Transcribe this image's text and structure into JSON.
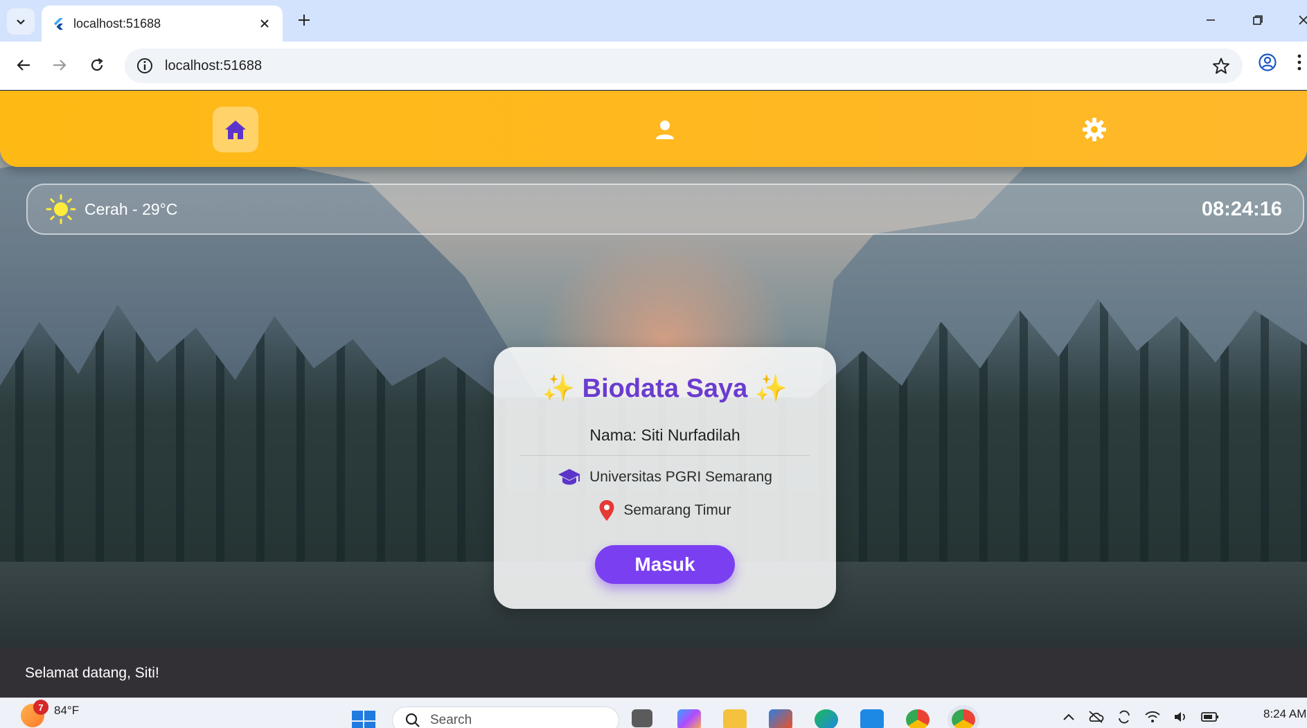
{
  "browser": {
    "tab_title": "localhost:51688",
    "url": "localhost:51688"
  },
  "app": {
    "nav_items": [
      {
        "name": "home",
        "icon": "home-icon",
        "active": true
      },
      {
        "name": "profile",
        "icon": "person-icon",
        "active": false
      },
      {
        "name": "settings",
        "icon": "gear-icon",
        "active": false
      }
    ],
    "accent_color": "#ffb914",
    "weather": {
      "icon": "sun-icon",
      "text": "Cerah - 29°C",
      "clock": "08:24:16"
    },
    "card": {
      "title": "✨ Biodata Saya ✨",
      "name": "Nama: Siti Nurfadilah",
      "university": "Universitas PGRI Semarang",
      "location": "Semarang Timur",
      "button_label": "Masuk",
      "button_color": "#7b3ff2",
      "title_color": "#6a3ccf"
    },
    "snackbar": "Selamat datang, Siti!"
  },
  "taskbar": {
    "weather_badge": "7",
    "weather_temp": "84°F",
    "search_placeholder": "Search",
    "time": "8:24 AM"
  }
}
